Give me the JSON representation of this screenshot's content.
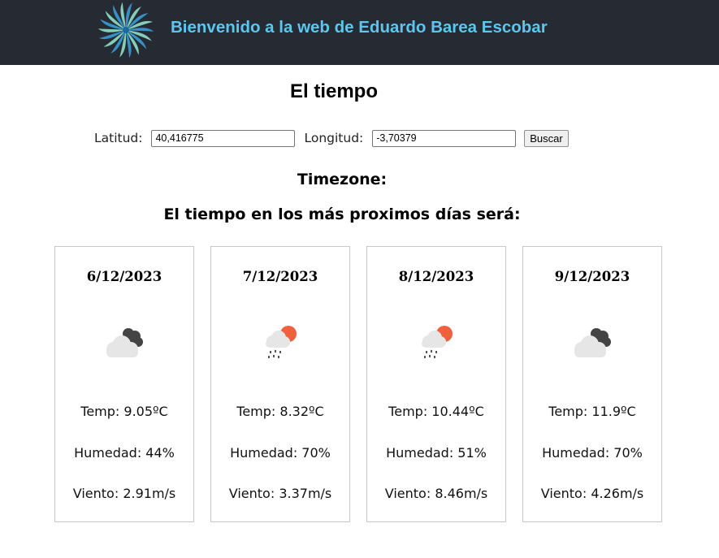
{
  "header": {
    "title": "Bienvenido a la web de Eduardo Barea Escobar",
    "logo_icon": "swirl-logo-icon"
  },
  "main": {
    "title": "El tiempo",
    "form": {
      "lat_label": "Latitud:",
      "lat_value": "40,416775",
      "lon_label": "Longitud:",
      "lon_value": "-3,70379",
      "search_label": "Buscar"
    },
    "timezone_label": "Timezone:",
    "forecast_heading": "El tiempo en los más proximos días será:"
  },
  "forecast": [
    {
      "date": "6/12/2023",
      "icon": "cloudy-icon",
      "temp": "Temp: 9.05ºC",
      "humidity": "Humedad: 44%",
      "wind": "Viento: 2.91m/s"
    },
    {
      "date": "7/12/2023",
      "icon": "sun-rain-icon",
      "temp": "Temp: 8.32ºC",
      "humidity": "Humedad: 70%",
      "wind": "Viento: 3.37m/s"
    },
    {
      "date": "8/12/2023",
      "icon": "sun-rain-icon",
      "temp": "Temp: 10.44ºC",
      "humidity": "Humedad: 51%",
      "wind": "Viento: 8.46m/s"
    },
    {
      "date": "9/12/2023",
      "icon": "cloudy-icon",
      "temp": "Temp: 11.9ºC",
      "humidity": "Humedad: 70%",
      "wind": "Viento: 4.26m/s"
    }
  ],
  "colors": {
    "header_bg": "#262a33",
    "header_text": "#5cc6f0",
    "sun": "#f0603f",
    "dark_cloud": "#444444",
    "light_cloud": "#e6e6e6"
  }
}
